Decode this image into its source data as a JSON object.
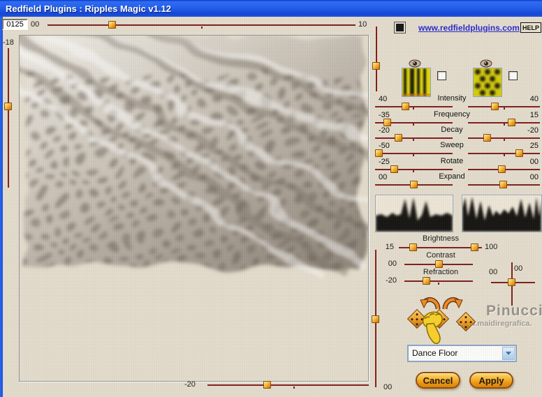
{
  "window": {
    "title": "Redfield Plugins : Ripples Magic v1.12"
  },
  "header": {
    "seed_value": "0125",
    "site_link": "www.redfieldplugins.com",
    "help_label": "HELP"
  },
  "top_slider": {
    "min_label": "00",
    "max_label": "10"
  },
  "left_slider": {
    "value_label": "-18"
  },
  "dual_sliders": [
    {
      "name": "Intensity",
      "left": "40",
      "right": "40"
    },
    {
      "name": "Frequency",
      "left": "-35",
      "right": "15"
    },
    {
      "name": "Decay",
      "left": "-20",
      "right": "-20"
    },
    {
      "name": "Sweep",
      "left": "-50",
      "right": "25"
    },
    {
      "name": "Rotate",
      "left": "-25",
      "right": "00"
    },
    {
      "name": "Expand",
      "left": "00",
      "right": "00"
    }
  ],
  "adjustments": {
    "brightness": {
      "label": "Brightness",
      "min": "15",
      "max": "100"
    },
    "contrast": {
      "label": "Contrast",
      "value": "00"
    },
    "refraction": {
      "label": "Refraction",
      "value": "-20"
    }
  },
  "offset_control": {
    "h_value": "00",
    "v_value": "00"
  },
  "right_vertical_slider": {
    "bottom_label": "00"
  },
  "bottom_slider": {
    "value_label": "-20"
  },
  "watermark": {
    "name": "Pinuccia",
    "site": "www.maidiregrafica."
  },
  "preset": {
    "selected": "Dance Floor"
  },
  "actions": {
    "cancel_label": "Cancel",
    "apply_label": "Apply"
  },
  "colors": {
    "title_bar_blue": "#1C52E0",
    "background_beige": "#E5DECE",
    "slider_track_maroon": "#7B1414",
    "handle_orange": "#F29B16",
    "link_blue": "#2121CE",
    "button_orange": "#F5A81E"
  }
}
